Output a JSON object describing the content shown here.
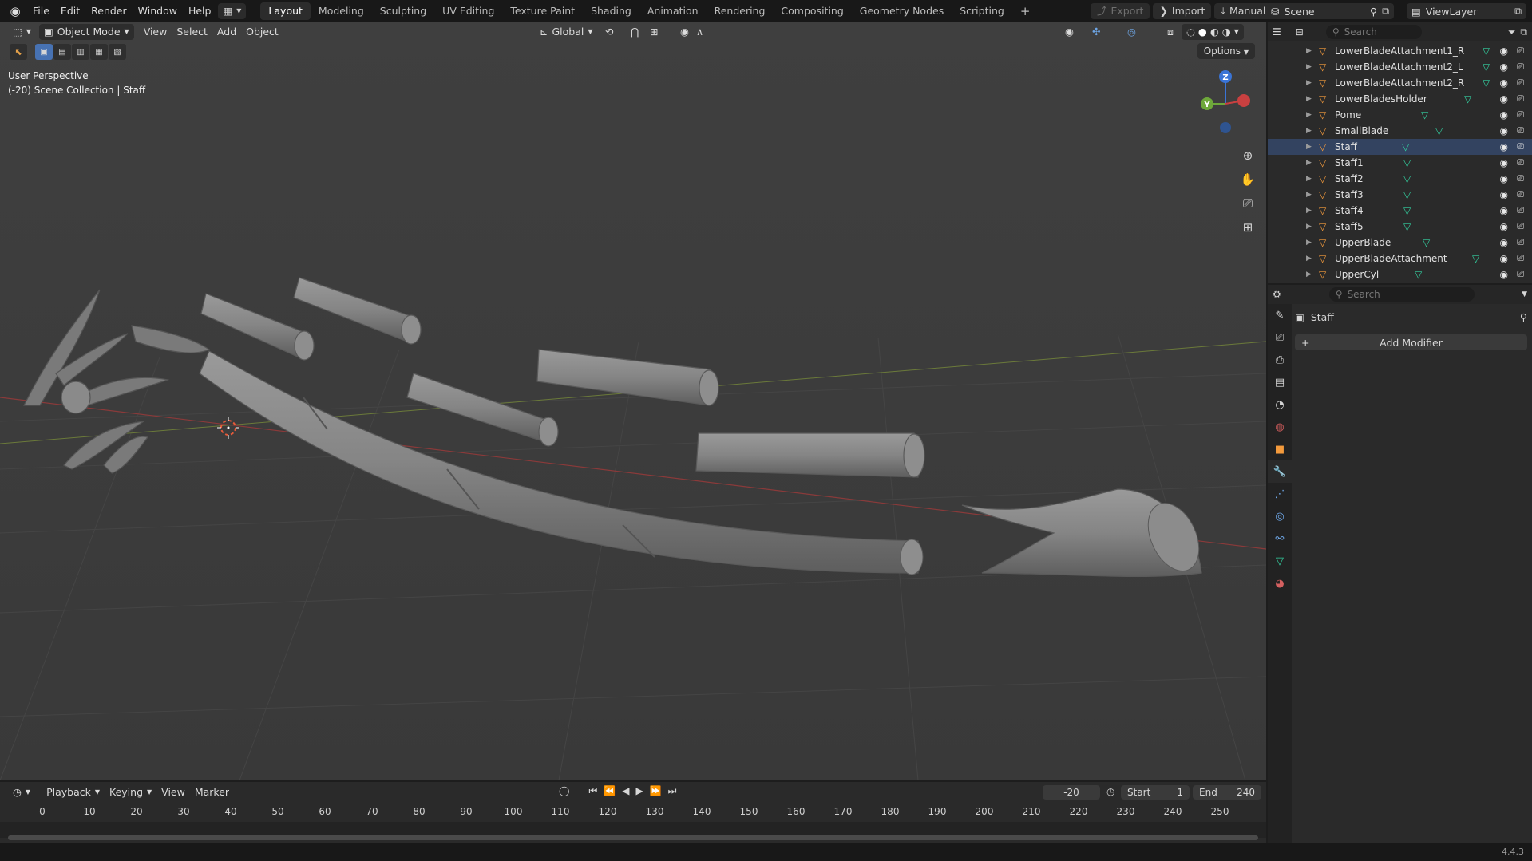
{
  "topbar": {
    "menus": [
      "File",
      "Edit",
      "Render",
      "Window",
      "Help"
    ],
    "workspaces": [
      "Layout",
      "Modeling",
      "Sculpting",
      "UV Editing",
      "Texture Paint",
      "Shading",
      "Animation",
      "Rendering",
      "Compositing",
      "Geometry Nodes",
      "Scripting"
    ],
    "active_workspace": "Layout",
    "export_label": "Export",
    "import_label": "Import",
    "manual_label": "Manual",
    "scene": "Scene",
    "view_layer": "ViewLayer"
  },
  "viewport": {
    "mode": "Object Mode",
    "menus": [
      "View",
      "Select",
      "Add",
      "Object"
    ],
    "transform_orientation": "Global",
    "options_label": "Options",
    "overlay_line1": "User Perspective",
    "overlay_line2": "(-20) Scene Collection | Staff",
    "gizmo": {
      "z": "Z",
      "y": "Y"
    }
  },
  "outliner": {
    "search_placeholder": "Search",
    "items": [
      {
        "name": "LowerBladeAttachment1_R",
        "active": false
      },
      {
        "name": "LowerBladeAttachment2_L",
        "active": false
      },
      {
        "name": "LowerBladeAttachment2_R",
        "active": false
      },
      {
        "name": "LowerBladesHolder",
        "active": false
      },
      {
        "name": "Pome",
        "active": false
      },
      {
        "name": "SmallBlade",
        "active": false
      },
      {
        "name": "Staff",
        "active": true
      },
      {
        "name": "Staff1",
        "active": false
      },
      {
        "name": "Staff2",
        "active": false
      },
      {
        "name": "Staff3",
        "active": false
      },
      {
        "name": "Staff4",
        "active": false
      },
      {
        "name": "Staff5",
        "active": false
      },
      {
        "name": "UpperBlade",
        "active": false
      },
      {
        "name": "UpperBladeAttachment",
        "active": false
      },
      {
        "name": "UpperCyl",
        "active": false
      }
    ]
  },
  "properties": {
    "search_placeholder": "Search",
    "object_name": "Staff",
    "add_modifier_label": "Add Modifier"
  },
  "timeline": {
    "menus": [
      "Playback",
      "Keying",
      "View",
      "Marker"
    ],
    "current_frame": "-20",
    "start_label": "Start",
    "start_value": "1",
    "end_label": "End",
    "end_value": "240",
    "ticks": [
      "0",
      "10",
      "20",
      "30",
      "40",
      "50",
      "60",
      "70",
      "80",
      "90",
      "100",
      "110",
      "120",
      "130",
      "140",
      "150",
      "160",
      "170",
      "180",
      "190",
      "200",
      "210",
      "220",
      "230",
      "240",
      "250"
    ]
  },
  "statusbar": {
    "version": "4.4.3"
  },
  "colors": {
    "accent": "#4772b3",
    "object_orange": "#f39a3c",
    "mesh_green": "#33d0a0",
    "viewport_bg": "#3d3d3d"
  }
}
